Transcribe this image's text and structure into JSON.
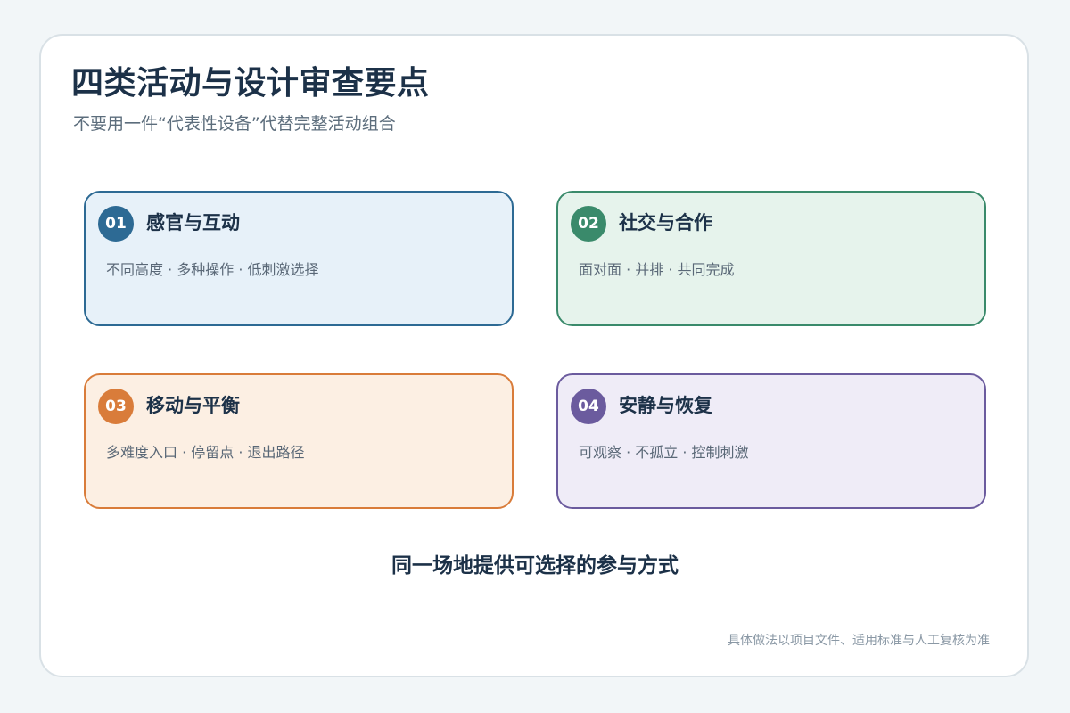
{
  "header": {
    "title": "四类活动与设计审查要点",
    "subtitle": "不要用一件“代表性设备”代替完整活动组合"
  },
  "cards": [
    {
      "number": "01",
      "title": "感官与互动",
      "description": "不同高度 · 多种操作 · 低刺激选择",
      "colors": {
        "accent": "#2d6a94",
        "border": "#2d6a94",
        "background": "#e7f1f9"
      }
    },
    {
      "number": "02",
      "title": "社交与合作",
      "description": "面对面 · 并排 · 共同完成",
      "colors": {
        "accent": "#3a8a6b",
        "border": "#3a8a6b",
        "background": "#e6f3ec"
      }
    },
    {
      "number": "03",
      "title": "移动与平衡",
      "description": "多难度入口 · 停留点 · 退出路径",
      "colors": {
        "accent": "#d97c3a",
        "border": "#d97c3a",
        "background": "#fcefe3"
      }
    },
    {
      "number": "04",
      "title": "安静与恢复",
      "description": "可观察 · 不孤立 · 控制刺激",
      "colors": {
        "accent": "#6b5b9e",
        "border": "#6b5b9e",
        "background": "#efecf7"
      }
    }
  ],
  "summary": "同一场地提供可选择的参与方式",
  "footnote": "具体做法以项目文件、适用标准与人工复核为准"
}
